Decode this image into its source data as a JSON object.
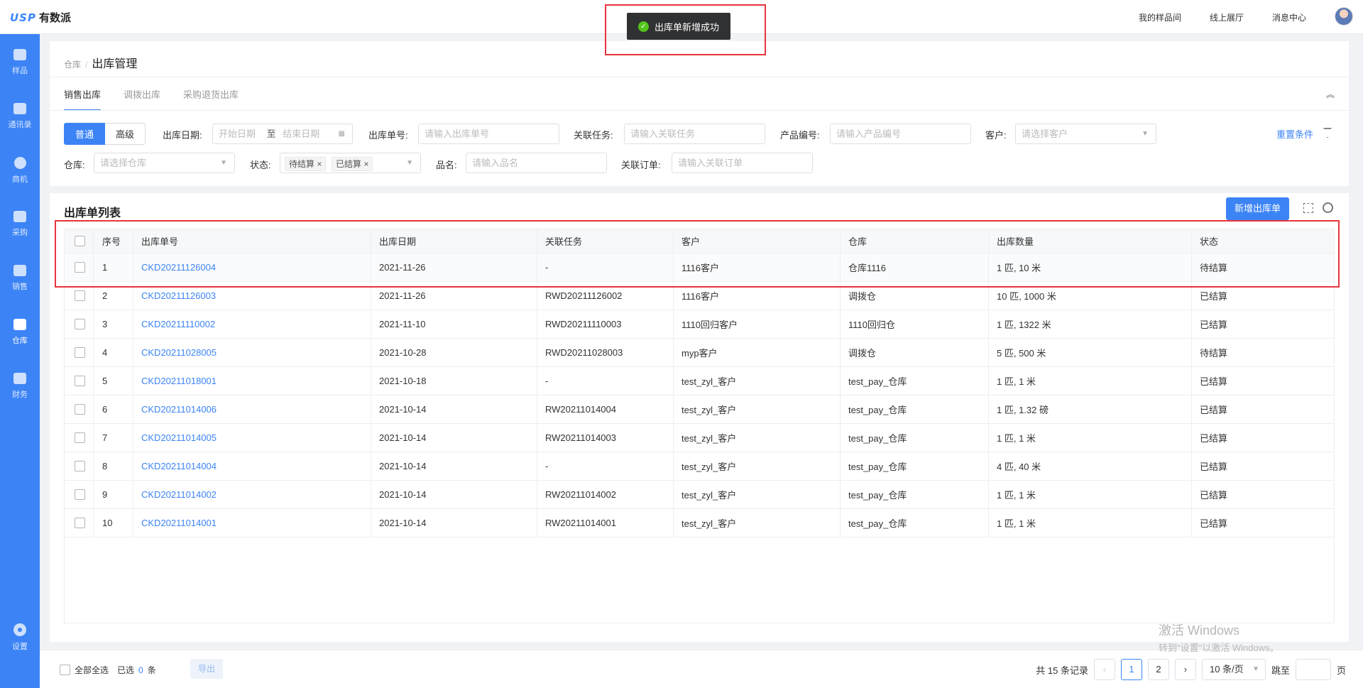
{
  "app": {
    "logo_mark": "USP",
    "logo_name": "有数派"
  },
  "topnav": [
    "我的样品间",
    "线上展厅",
    "消息中心"
  ],
  "sidebar": [
    {
      "label": "样品",
      "icon": "sample-icon"
    },
    {
      "label": "通讯录",
      "icon": "contacts-icon"
    },
    {
      "label": "商机",
      "icon": "opportunity-icon"
    },
    {
      "label": "采购",
      "icon": "purchase-icon"
    },
    {
      "label": "销售",
      "icon": "sales-icon"
    },
    {
      "label": "仓库",
      "icon": "warehouse-icon",
      "active": true
    },
    {
      "label": "财务",
      "icon": "finance-icon"
    },
    {
      "label": "设置",
      "icon": "settings-icon"
    }
  ],
  "toast": "出库单新增成功",
  "breadcrumb": {
    "parent": "仓库",
    "sep": "/",
    "current": "出库管理"
  },
  "tabs": [
    "销售出库",
    "调拨出库",
    "采购退货出库"
  ],
  "filters": {
    "mode_normal": "普通",
    "mode_advanced": "高级",
    "date_label": "出库日期:",
    "date_start": "开始日期",
    "date_to": "至",
    "date_end": "结束日期",
    "order_no_label": "出库单号:",
    "order_no_ph": "请输入出库单号",
    "task_label": "关联任务:",
    "task_ph": "请输入关联任务",
    "product_label": "产品编号:",
    "product_ph": "请输入产品编号",
    "customer_label": "客户:",
    "customer_ph": "请选择客户",
    "reset": "重置条件",
    "warehouse_label": "仓库:",
    "warehouse_ph": "请选择仓库",
    "status_label": "状态:",
    "status_tags": [
      "待结算",
      "已结算"
    ],
    "name_label": "品名:",
    "name_ph": "请输入品名",
    "linked_order_label": "关联订单:",
    "linked_order_ph": "请输入关联订单"
  },
  "list": {
    "title": "出库单列表",
    "add_button": "新增出库单",
    "columns": [
      "序号",
      "出库单号",
      "出库日期",
      "关联任务",
      "客户",
      "仓库",
      "出库数量",
      "状态"
    ],
    "rows": [
      [
        "1",
        "CKD20211126004",
        "2021-11-26",
        "-",
        "1116客户",
        "仓库1116",
        "1 匹, 10 米",
        "待结算"
      ],
      [
        "2",
        "CKD20211126003",
        "2021-11-26",
        "RWD20211126002",
        "1116客户",
        "调拨仓",
        "10 匹, 1000 米",
        "已结算"
      ],
      [
        "3",
        "CKD20211110002",
        "2021-11-10",
        "RWD20211110003",
        "1110回归客户",
        "1110回归仓",
        "1 匹, 1322 米",
        "已结算"
      ],
      [
        "4",
        "CKD20211028005",
        "2021-10-28",
        "RWD20211028003",
        "myp客户",
        "调拨仓",
        "5 匹, 500 米",
        "待结算"
      ],
      [
        "5",
        "CKD20211018001",
        "2021-10-18",
        "-",
        "test_zyl_客户",
        "test_pay_仓库",
        "1 匹, 1 米",
        "已结算"
      ],
      [
        "6",
        "CKD20211014006",
        "2021-10-14",
        "RW20211014004",
        "test_zyl_客户",
        "test_pay_仓库",
        "1 匹, 1.32 磅",
        "已结算"
      ],
      [
        "7",
        "CKD20211014005",
        "2021-10-14",
        "RW20211014003",
        "test_zyl_客户",
        "test_pay_仓库",
        "1 匹, 1 米",
        "已结算"
      ],
      [
        "8",
        "CKD20211014004",
        "2021-10-14",
        "-",
        "test_zyl_客户",
        "test_pay_仓库",
        "4 匹, 40 米",
        "已结算"
      ],
      [
        "9",
        "CKD20211014002",
        "2021-10-14",
        "RW20211014002",
        "test_zyl_客户",
        "test_pay_仓库",
        "1 匹, 1 米",
        "已结算"
      ],
      [
        "10",
        "CKD20211014001",
        "2021-10-14",
        "RW20211014001",
        "test_zyl_客户",
        "test_pay_仓库",
        "1 匹, 1 米",
        "已结算"
      ]
    ]
  },
  "footer": {
    "select_all": "全部全选",
    "selected_prefix": "已选",
    "selected_count": "0",
    "selected_unit": "条",
    "export": "导出",
    "total": "共 15 条记录",
    "pages": [
      "1",
      "2"
    ],
    "current_page": "1",
    "page_size": "10 条/页",
    "jump_label": "跳至",
    "jump_unit": "页"
  },
  "watermark": {
    "line1": "激活 Windows",
    "line2": "转到\"设置\"以激活 Windows。"
  },
  "colors": {
    "primary": "#3c84f5",
    "highlight": "#e8343c",
    "success": "#52c41a"
  }
}
